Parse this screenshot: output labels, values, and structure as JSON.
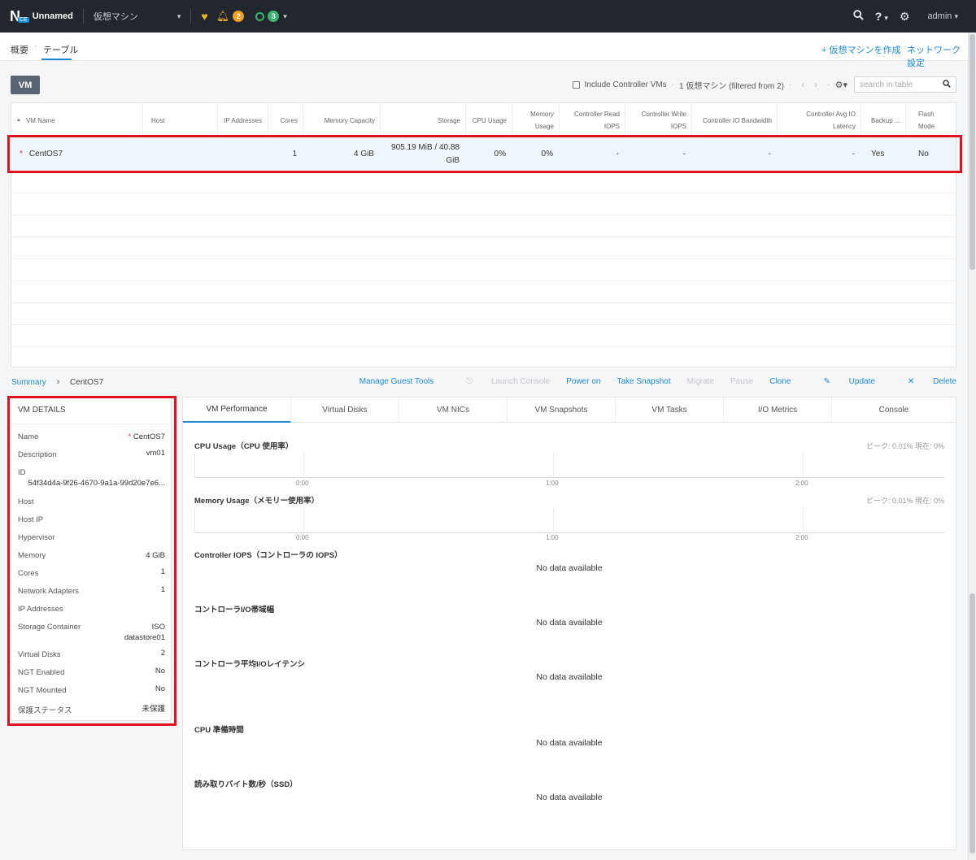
{
  "topbar": {
    "logo_letter": "N",
    "logo_badge": "CE",
    "cluster_name": "Unnamed",
    "menu": "仮想マシン",
    "alerts_count": "2",
    "tasks_count": "3",
    "user": "admin",
    "caret": "⌄",
    "help": "?"
  },
  "subnav": {
    "tabs": [
      "概要",
      "テーブル"
    ],
    "separator": "·",
    "create_vm": "+ 仮想マシンを作成",
    "network_settings": "ネットワーク設定"
  },
  "toolbar": {
    "vm_button": "VM",
    "include_controller": "Include Controller VMs",
    "filter_status": "1 仮想マシン (filtered from 2)",
    "search_placeholder": "search in table"
  },
  "table": {
    "columns": [
      "VM Name",
      "Host",
      "IP Addresses",
      "Cores",
      "Memory Capacity",
      "Storage",
      "CPU Usage",
      "Memory Usage",
      "Controller Read IOPS",
      "Controller Write IOPS",
      "Controller IO Bandwidth",
      "Controller Avg IO Latency",
      "Backup ...",
      "Flash Mode"
    ],
    "rows": [
      {
        "vm_name": "CentOS7",
        "host": "",
        "ip": "",
        "cores": "1",
        "memory": "4 GiB",
        "storage": "905.19 MiB / 40.88 GiB",
        "cpu": "0%",
        "mem_usage": "0%",
        "read_iops": "-",
        "write_iops": "-",
        "io_bw": "-",
        "latency": "-",
        "backup": "Yes",
        "flash": "No"
      }
    ]
  },
  "breadcrumb": {
    "root": "Summary",
    "current": "CentOS7"
  },
  "actions": {
    "manage_guest_tools": "Manage Guest Tools",
    "launch_console": "Launch Console",
    "power_on": "Power on",
    "take_snapshot": "Take Snapshot",
    "migrate": "Migrate",
    "pause": "Pause",
    "clone": "Clone",
    "update": "Update",
    "delete": "Delete"
  },
  "details": {
    "title": "VM DETAILS",
    "rows": [
      {
        "label": "Name",
        "value": "CentOS7"
      },
      {
        "label": "Description",
        "value": "vm01"
      },
      {
        "label": "ID",
        "value": "54f34d4a-9f26-4670-9a1a-99d20e7e6..."
      },
      {
        "label": "Host",
        "value": ""
      },
      {
        "label": "Host IP",
        "value": ""
      },
      {
        "label": "Hypervisor",
        "value": ""
      },
      {
        "label": "Memory",
        "value": "4 GiB"
      },
      {
        "label": "Cores",
        "value": "1"
      },
      {
        "label": "Network Adapters",
        "value": "1"
      },
      {
        "label": "IP Addresses",
        "value": ""
      },
      {
        "label": "Storage Container",
        "value": "ISO",
        "value2": "datastore01"
      },
      {
        "label": "Virtual Disks",
        "value": "2"
      },
      {
        "label": "NGT Enabled",
        "value": "No"
      },
      {
        "label": "NGT Mounted",
        "value": "No"
      },
      {
        "label": "保護ステータス",
        "value": "未保護"
      }
    ]
  },
  "perf": {
    "tabs": [
      "VM Performance",
      "Virtual Disks",
      "VM NICs",
      "VM Snapshots",
      "VM Tasks",
      "I/O Metrics",
      "Console"
    ],
    "cpu_title": "CPU Usage（CPU 使用率）",
    "cpu_stat": "ピーク: 0.01%   現在: 0%",
    "mem_title": "Memory Usage（メモリー使用率）",
    "mem_stat": "ピーク: 0.01%   現在: 0%",
    "ticks": [
      "0:00",
      "1:00",
      "2:00"
    ],
    "iops_title": "Controller IOPS（コントローラの IOPS）",
    "bw_title": "コントローラI/O帯域幅",
    "latency_title": "コントローラ平均I/Oレイテンシ",
    "cpu_ready_title": "CPU 準備時間",
    "read_bytes_title": "読み取りバイト数/秒（SSD）",
    "no_data": "No data available"
  },
  "colors": {
    "accent": "#1d8ad8",
    "topbar": "#22272e",
    "highlight": "#e0141e"
  },
  "icons": [
    "heart-icon",
    "bell-icon",
    "circle-icon",
    "search-icon",
    "help-icon",
    "gear-icon",
    "sort-icon",
    "chevron-left-icon",
    "chevron-right-icon",
    "pencil-icon",
    "close-icon"
  ]
}
